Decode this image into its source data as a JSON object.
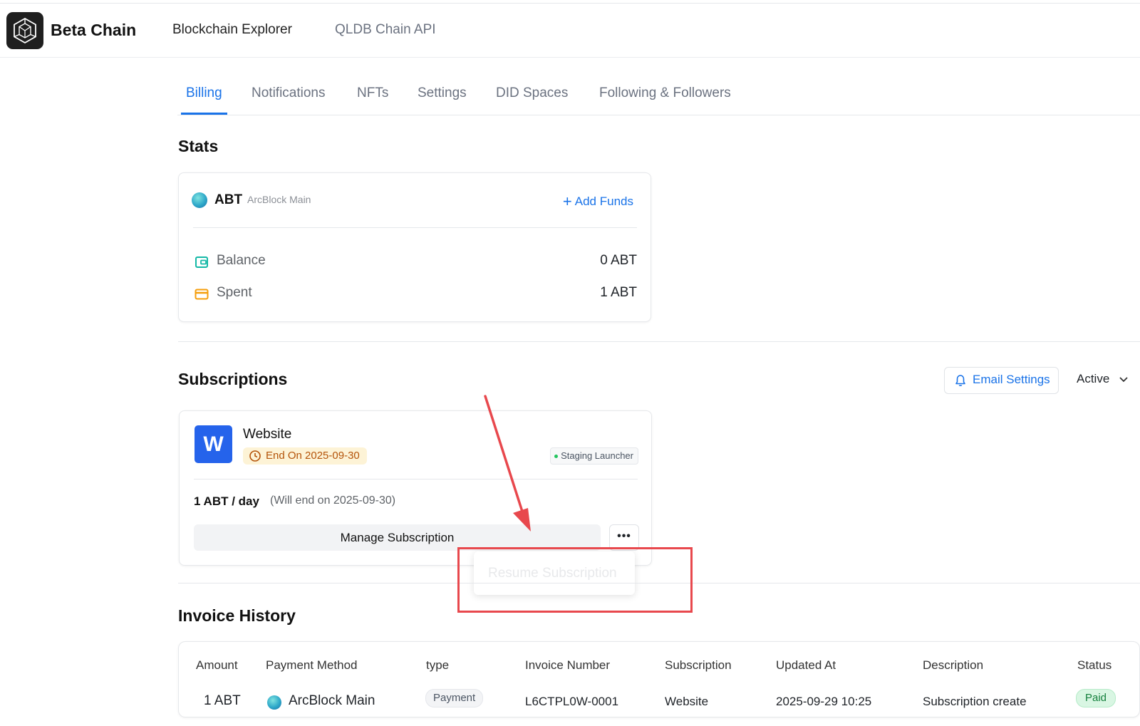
{
  "header": {
    "brand": "Beta Chain",
    "nav": [
      "Blockchain Explorer",
      "QLDB Chain API"
    ]
  },
  "tabs": [
    "Billing",
    "Notifications",
    "NFTs",
    "Settings",
    "DID Spaces",
    "Following & Followers"
  ],
  "active_tab": "Billing",
  "stats": {
    "title": "Stats",
    "token": "ABT",
    "chain": "ArcBlock Main",
    "add_funds": "Add Funds",
    "rows": [
      {
        "label": "Balance",
        "value": "0 ABT",
        "icon": "wallet-icon",
        "color": "#14b8a6"
      },
      {
        "label": "Spent",
        "value": "1 ABT",
        "icon": "credit-card-icon",
        "color": "#f59e0b"
      }
    ]
  },
  "subscriptions": {
    "title": "Subscriptions",
    "email_settings": "Email Settings",
    "filter": "Active",
    "card": {
      "avatar_letter": "W",
      "name": "Website",
      "end_badge": "End On 2025-09-30",
      "app_badge": "Staging Launcher",
      "price": "1 ABT / day",
      "price_note": "(Will end on 2025-09-30)",
      "manage": "Manage Subscription",
      "more": "•••"
    },
    "menu": {
      "resume": "Resume Subscription"
    }
  },
  "invoices": {
    "title": "Invoice History",
    "columns": [
      "Amount",
      "Payment Method",
      "type",
      "Invoice Number",
      "Subscription",
      "Updated At",
      "Description",
      "Status"
    ],
    "rows": [
      {
        "amount": "1 ABT",
        "method": "ArcBlock Main",
        "type": "Payment",
        "number": "L6CTPL0W-0001",
        "subscription": "Website",
        "updated": "2025-09-29 10:25",
        "description": "Subscription create",
        "status": "Paid"
      }
    ]
  },
  "colors": {
    "accent": "#1a73e8",
    "annotation": "#e8484d",
    "paid": "#15803d",
    "warning": "#b45309"
  }
}
